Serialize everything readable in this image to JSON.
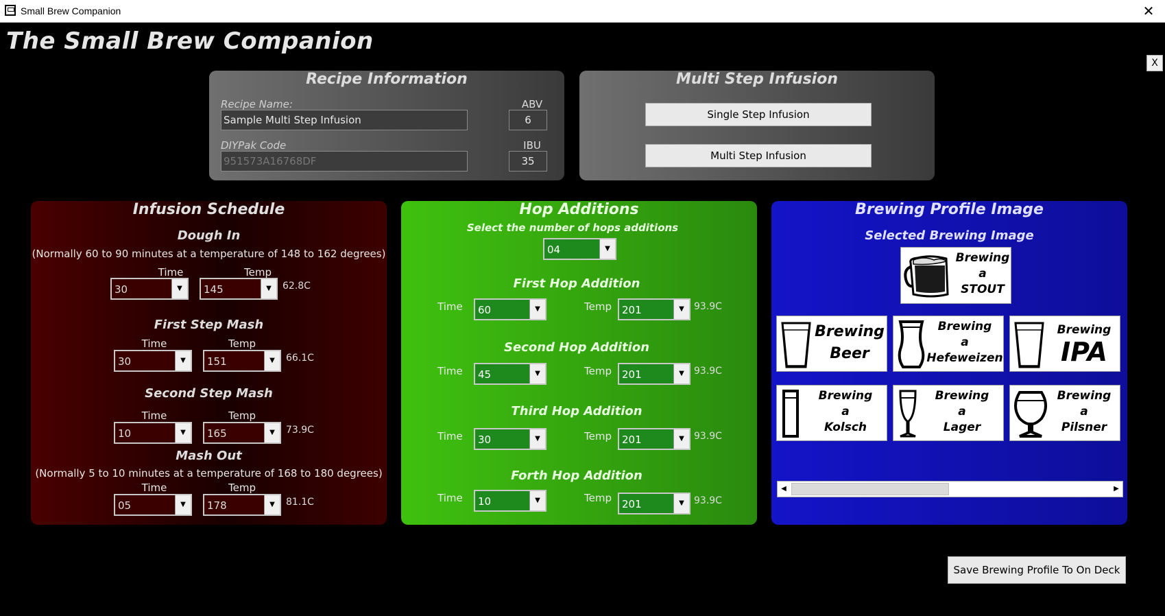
{
  "window": {
    "title": "Small Brew Companion",
    "close_glyph": "✕"
  },
  "app_title": "The Small Brew Companion",
  "small_close": "X",
  "recipe": {
    "title": "Recipe Information",
    "name_label": "Recipe Name:",
    "name_value": "Sample Multi Step Infusion",
    "abv_label": "ABV",
    "abv_value": "6",
    "code_label": "DIYPak Code",
    "code_value": "951573A16768DF",
    "ibu_label": "IBU",
    "ibu_value": "35"
  },
  "msi": {
    "title": "Multi Step Infusion",
    "single_button": "Single Step Infusion",
    "multi_button": "Multi Step Infusion"
  },
  "infusion": {
    "title": "Infusion Schedule",
    "dough_in": {
      "title": "Dough In",
      "note": "(Normally 60 to 90 minutes at a temperature of 148 to 162 degrees)",
      "time_label": "Time",
      "temp_label": "Temp",
      "time": "30",
      "temp": "145",
      "celsius": "62.8C"
    },
    "first_step": {
      "title": "First Step Mash",
      "time_label": "Time",
      "temp_label": "Temp",
      "time": "30",
      "temp": "151",
      "celsius": "66.1C"
    },
    "second_step": {
      "title": "Second Step Mash",
      "time_label": "Time",
      "temp_label": "Temp",
      "time": "10",
      "temp": "165",
      "celsius": "73.9C"
    },
    "mash_out": {
      "title": "Mash Out",
      "note": "(Normally 5 to 10 minutes at a temperature of 168 to 180 degrees)",
      "time_label": "Time",
      "temp_label": "Temp",
      "time": "05",
      "temp": "178",
      "celsius": "81.1C"
    }
  },
  "hops": {
    "title": "Hop Additions",
    "select_label": "Select the number of hops additions",
    "count": "04",
    "additions": [
      {
        "title": "First Hop Addition",
        "time_label": "Time",
        "temp_label": "Temp",
        "time": "60",
        "temp": "201",
        "celsius": "93.9C"
      },
      {
        "title": "Second Hop Addition",
        "time_label": "Time",
        "temp_label": "Temp",
        "time": "45",
        "temp": "201",
        "celsius": "93.9C"
      },
      {
        "title": "Third Hop Addition",
        "time_label": "Time",
        "temp_label": "Temp",
        "time": "30",
        "temp": "201",
        "celsius": "93.9C"
      },
      {
        "title": "Forth Hop Addition",
        "time_label": "Time",
        "temp_label": "Temp",
        "time": "10",
        "temp": "201",
        "celsius": "93.9C"
      }
    ]
  },
  "profile": {
    "title": "Brewing Profile Image",
    "selected_label": "Selected Brewing Image",
    "selected": {
      "line1": "Brewing",
      "line2": "a",
      "line3": "STOUT",
      "icon": "stout-mug-icon"
    },
    "tiles": [
      {
        "line1": "Brewing",
        "line2": "Beer",
        "icon": "pint-glass-icon"
      },
      {
        "line1": "Brewing",
        "line2": "a",
        "line3": "Hefeweizen",
        "icon": "weizen-glass-icon"
      },
      {
        "line1": "Brewing",
        "line2": "IPA",
        "icon": "pint-glass-icon"
      },
      {
        "line1": "Brewing",
        "line2": "a",
        "line3": "Kolsch",
        "icon": "kolsch-glass-icon"
      },
      {
        "line1": "Brewing",
        "line2": "a",
        "line3": "Lager",
        "icon": "flute-glass-icon"
      },
      {
        "line1": "Brewing",
        "line2": "a",
        "line3": "Pilsner",
        "icon": "snifter-glass-icon"
      }
    ]
  },
  "save_button": "Save Brewing Profile To On Deck",
  "colors": {
    "infusion_bg": "#3a0000",
    "hop_bg": "#38b00f",
    "profile_bg": "#1212b4",
    "recipe_bg": "#5a5a5a"
  }
}
